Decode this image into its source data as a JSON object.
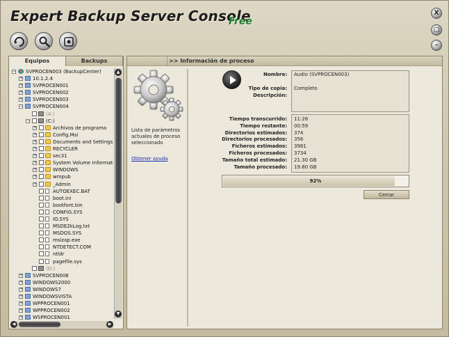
{
  "app": {
    "title": "Expert Backup Server Console",
    "edition": "Free"
  },
  "window_controls": {
    "close": "X",
    "maximize": "□",
    "minimize": "–"
  },
  "toolbar": [
    {
      "name": "backup-icon"
    },
    {
      "name": "search-icon"
    },
    {
      "name": "settings-icon"
    }
  ],
  "left_panel": {
    "tabs": [
      "Equipos",
      "Backups"
    ],
    "tree": [
      {
        "depth": 0,
        "exp": "-",
        "icon": "net",
        "label": "SVPROCEN003 (BackupCenter)"
      },
      {
        "depth": 1,
        "exp": "+",
        "icon": "pc",
        "label": "10.1.2.4"
      },
      {
        "depth": 1,
        "exp": "+",
        "icon": "pc",
        "label": "SVPROCEN001"
      },
      {
        "depth": 1,
        "exp": "+",
        "icon": "pc",
        "label": "SVPROCEN002"
      },
      {
        "depth": 1,
        "exp": "+",
        "icon": "pc",
        "label": "SVPROCEN003"
      },
      {
        "depth": 1,
        "exp": "-",
        "icon": "pc",
        "label": "SVPROCEN004"
      },
      {
        "depth": 2,
        "exp": "",
        "cb": true,
        "icon": "drive",
        "label": "(A:)",
        "dim": true
      },
      {
        "depth": 2,
        "exp": "-",
        "cb": true,
        "icon": "drive",
        "label": "(C:)"
      },
      {
        "depth": 3,
        "exp": "+",
        "cb": true,
        "icon": "folder",
        "label": "Archivos de programa"
      },
      {
        "depth": 3,
        "exp": "+",
        "cb": true,
        "icon": "folder",
        "label": "Config.Msi"
      },
      {
        "depth": 3,
        "exp": "+",
        "cb": true,
        "icon": "folder",
        "label": "Documents and Settings"
      },
      {
        "depth": 3,
        "exp": "+",
        "cb": true,
        "icon": "folder",
        "label": "RECYCLER"
      },
      {
        "depth": 3,
        "exp": "+",
        "cb": true,
        "icon": "folder",
        "label": "sec31"
      },
      {
        "depth": 3,
        "exp": "+",
        "cb": true,
        "icon": "folder",
        "label": "System Volume Informatic"
      },
      {
        "depth": 3,
        "exp": "+",
        "cb": true,
        "icon": "folder",
        "label": "WINDOWS"
      },
      {
        "depth": 3,
        "exp": "+",
        "cb": true,
        "icon": "folder",
        "label": "wmpub"
      },
      {
        "depth": 3,
        "exp": "+",
        "cb": true,
        "icon": "folder",
        "label": "_Admin"
      },
      {
        "depth": 3,
        "exp": "",
        "cb": true,
        "icon": "file",
        "label": "AUTOEXEC.BAT"
      },
      {
        "depth": 3,
        "exp": "",
        "cb": true,
        "icon": "file",
        "label": "boot.ini"
      },
      {
        "depth": 3,
        "exp": "",
        "cb": true,
        "icon": "file",
        "label": "bootfont.bin"
      },
      {
        "depth": 3,
        "exp": "",
        "cb": true,
        "icon": "file",
        "label": "CONFIG.SYS"
      },
      {
        "depth": 3,
        "exp": "",
        "cb": true,
        "icon": "file",
        "label": "IO.SYS"
      },
      {
        "depth": 3,
        "exp": "",
        "cb": true,
        "icon": "file",
        "label": "MSDE2kLog.txt"
      },
      {
        "depth": 3,
        "exp": "",
        "cb": true,
        "icon": "file",
        "label": "MSDOS.SYS"
      },
      {
        "depth": 3,
        "exp": "",
        "cb": true,
        "icon": "file",
        "label": "msizap.exe"
      },
      {
        "depth": 3,
        "exp": "",
        "cb": true,
        "icon": "file",
        "label": "NTDETECT.COM"
      },
      {
        "depth": 3,
        "exp": "",
        "cb": true,
        "icon": "file",
        "label": "ntldr"
      },
      {
        "depth": 3,
        "exp": "",
        "cb": true,
        "icon": "file",
        "label": "pagefile.sys"
      },
      {
        "depth": 2,
        "exp": "",
        "cb": true,
        "icon": "drive",
        "label": "(D:)",
        "dim": true
      },
      {
        "depth": 1,
        "exp": "+",
        "icon": "pc",
        "label": "SVPROCEN008"
      },
      {
        "depth": 1,
        "exp": "+",
        "icon": "pc",
        "label": "WINDOWS2000"
      },
      {
        "depth": 1,
        "exp": "+",
        "icon": "pc",
        "label": "WINDOWS7"
      },
      {
        "depth": 1,
        "exp": "+",
        "icon": "pc",
        "label": "WINDOWSVISTA"
      },
      {
        "depth": 1,
        "exp": "+",
        "icon": "pc",
        "label": "WPPROCEN001"
      },
      {
        "depth": 1,
        "exp": "+",
        "icon": "pc",
        "label": "WPPROCEN002"
      },
      {
        "depth": 1,
        "exp": "+",
        "icon": "pc",
        "label": "WSPROCEN001"
      }
    ]
  },
  "right_panel": {
    "header": ">> Información de proceso",
    "description": "Lista de parámetros actuales de proceso seleccionado",
    "help_link": "Obtener ayuda",
    "fields_top": [
      {
        "label": "Nombre:",
        "value": "Audio (SVPROCEN003)"
      },
      {
        "label": "Tipo de copia:",
        "value": "Completo"
      },
      {
        "label": "Descripción:",
        "value": ""
      }
    ],
    "fields_bottom": [
      {
        "label": "Tiempo transcurrido:",
        "value": "11:26"
      },
      {
        "label": "Tiempo restante:",
        "value": "00:59"
      },
      {
        "label": "Directorios estimados:",
        "value": "374"
      },
      {
        "label": "Directorios procesados:",
        "value": "356"
      },
      {
        "label": "Ficheros estimados:",
        "value": "3981"
      },
      {
        "label": "Ficheros procesados:",
        "value": "3734"
      },
      {
        "label": "Tamaño total estimado:",
        "value": "21.30 GB"
      },
      {
        "label": "Tamaño procesado:",
        "value": "19.80 GB"
      }
    ],
    "progress": {
      "value": 0.92,
      "text": "92%"
    },
    "close_button": "Cerrar"
  }
}
